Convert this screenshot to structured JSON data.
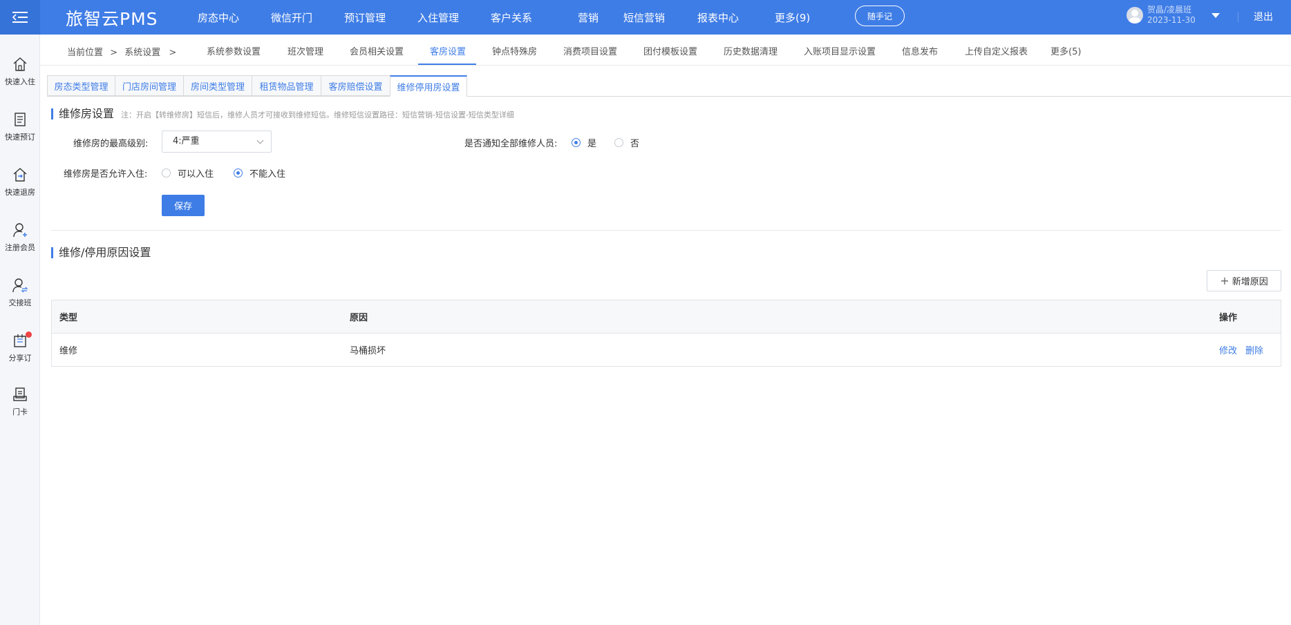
{
  "header": {
    "logo": "旅智云PMS",
    "nav": [
      "房态中心",
      "微信开门",
      "预订管理",
      "入住管理",
      "客户关系",
      "营销",
      "短信营销",
      "报表中心",
      "更多(9)"
    ],
    "memo_button": "随手记",
    "user_name": "贺晶/凌晨班",
    "date": "2023-11-30",
    "logout": "退出"
  },
  "sidebar": {
    "items": [
      {
        "label": "快速入住",
        "icon": "home-icon"
      },
      {
        "label": "快速预订",
        "icon": "document-icon"
      },
      {
        "label": "快速退房",
        "icon": "checkout-icon"
      },
      {
        "label": "注册会员",
        "icon": "user-add-icon"
      },
      {
        "label": "交接班",
        "icon": "user-swap-icon"
      },
      {
        "label": "分享订",
        "icon": "share-icon"
      },
      {
        "label": "门卡",
        "icon": "card-icon"
      }
    ]
  },
  "breadcrumb": {
    "current": "当前位置",
    "sep": ">",
    "level1": "系统设置",
    "sep2": ">"
  },
  "subnav": {
    "items": [
      "系统参数设置",
      "班次管理",
      "会员相关设置",
      "客房设置",
      "钟点特殊房",
      "消费项目设置",
      "团付模板设置",
      "历史数据清理",
      "入账项目显示设置",
      "信息发布",
      "上传自定义报表",
      "更多(5)"
    ],
    "active": "客房设置"
  },
  "tabs": {
    "items": [
      "房态类型管理",
      "门店房间管理",
      "房间类型管理",
      "租赁物品管理",
      "客房赔偿设置",
      "维修停用房设置"
    ],
    "active": "维修停用房设置"
  },
  "section1": {
    "title": "维修房设置",
    "note": "注：开启【转维修房】短信后，维修人员才可接收到维修短信。维修短信设置路径：短信营销-短信设置-短信类型详细",
    "max_level_label": "维修房的最高级别:",
    "max_level_value": "4:严重",
    "notify_label": "是否通知全部维修人员:",
    "notify_yes": "是",
    "notify_no": "否",
    "notify_selected": "是",
    "allow_label": "维修房是否允许入住:",
    "allow_option1": "可以入住",
    "allow_option2": "不能入住",
    "allow_selected": "不能入住",
    "save": "保存"
  },
  "section2": {
    "title": "维修/停用原因设置",
    "add_button": "新增原因",
    "columns": {
      "type": "类型",
      "reason": "原因",
      "action": "操作"
    },
    "rows": [
      {
        "type": "维修",
        "reason": "马桶损坏",
        "edit": "修改",
        "delete": "删除"
      }
    ]
  },
  "colors": {
    "primary": "#3f7de6",
    "badge": "#f04343"
  }
}
